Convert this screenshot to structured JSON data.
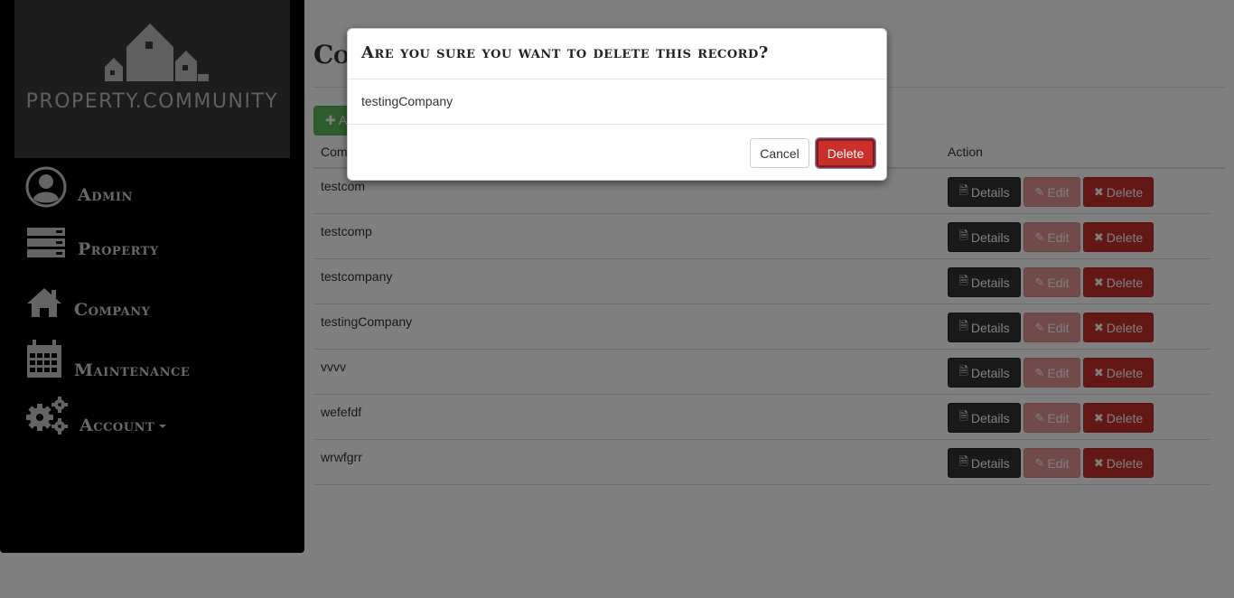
{
  "brand": {
    "name": "PROPERTY.COMMUNITY"
  },
  "nav": [
    {
      "label": "Admin",
      "icon": "user-circle-icon"
    },
    {
      "label": "Property",
      "icon": "server-icon"
    },
    {
      "label": "Company",
      "icon": "home-icon"
    },
    {
      "label": "Maintenance",
      "icon": "calendar-icon"
    },
    {
      "label": "Account",
      "icon": "gears-icon"
    }
  ],
  "page": {
    "title": "Companies",
    "create_label": "Add"
  },
  "table": {
    "headers": [
      "Company",
      "Action"
    ],
    "rows": [
      {
        "name": "testcom"
      },
      {
        "name": "testcomp"
      },
      {
        "name": "testcompany"
      },
      {
        "name": "testingCompany"
      },
      {
        "name": "vvvv"
      },
      {
        "name": "wefefdf"
      },
      {
        "name": "wrwfgrr"
      }
    ],
    "actions": {
      "details": "Details",
      "edit": "Edit",
      "delete": "Delete"
    }
  },
  "modal": {
    "title": "Are you sure you want to delete this record?",
    "body": "testingCompany",
    "cancel_label": "Cancel",
    "delete_label": "Delete"
  },
  "colors": {
    "sidebar_bg": "#000000",
    "logo_bg": "#3a3a3a",
    "create_btn": "#5cb85c",
    "details_btn": "#333333",
    "edit_btn": "#e08a8a",
    "delete_btn": "#c9302c",
    "overlay": "rgba(0,0,0,0.5)"
  }
}
